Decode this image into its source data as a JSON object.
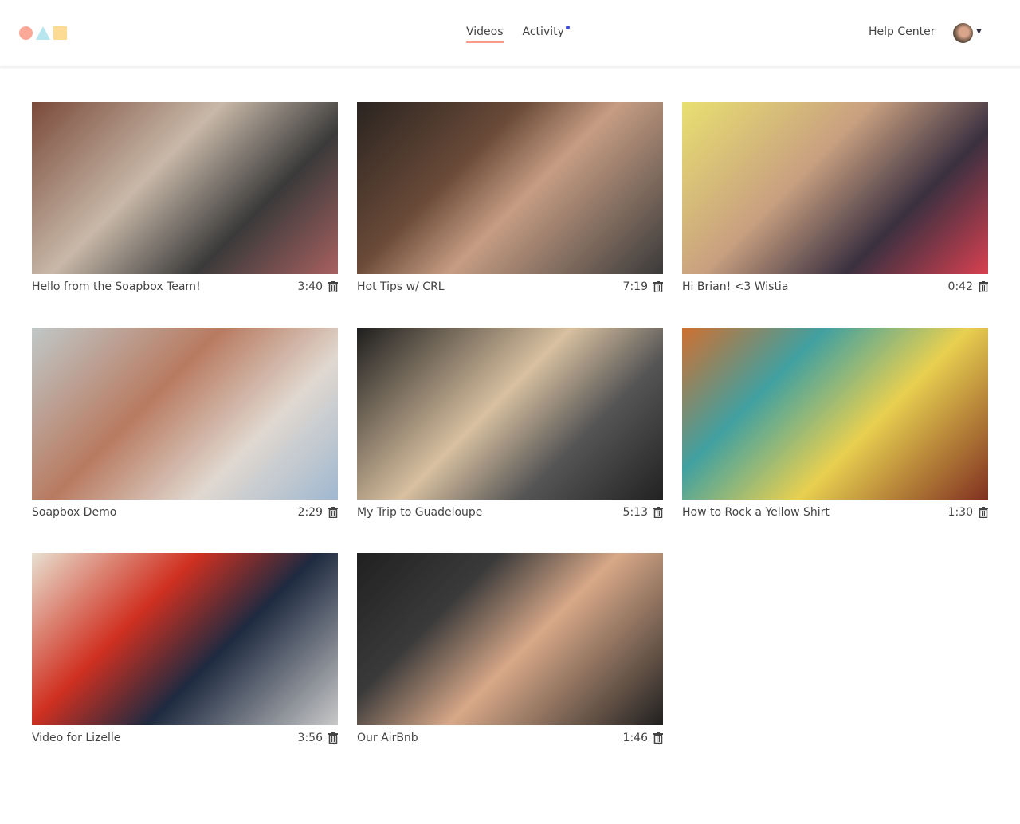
{
  "nav": {
    "videos": "Videos",
    "activity": "Activity",
    "help": "Help Center"
  },
  "colors": {
    "accent": "#fc9a88",
    "notification": "#3b4bd8"
  },
  "videos": [
    {
      "title": "Hello from the Soapbox Team!",
      "duration": "3:40",
      "bg": "linear-gradient(135deg,#7a4a3a 0%,#c8b8a8 40%,#3a3a3a 70%,#a86060 100%)"
    },
    {
      "title": "Hot Tips w/ CRL",
      "duration": "7:19",
      "bg": "linear-gradient(135deg,#2a2420 0%,#6a4a38 35%,#c79d83 55%,#3a3a3a 100%)"
    },
    {
      "title": "Hi Brian! <3 Wistia",
      "duration": "0:42",
      "bg": "linear-gradient(135deg,#e8e070 0%,#c9a080 40%,#3a3040 70%,#d84050 100%)"
    },
    {
      "title": "Soapbox Demo",
      "duration": "2:29",
      "bg": "linear-gradient(135deg,#c0c8c8 0%,#b87a60 40%,#e0d8d0 70%,#a0b8d0 100%)"
    },
    {
      "title": "My Trip to Guadeloupe",
      "duration": "5:13",
      "bg": "linear-gradient(135deg,#1e1e1e 0%,#d8c0a0 45%,#555 70%,#222 100%)"
    },
    {
      "title": "How to Rock a Yellow Shirt",
      "duration": "1:30",
      "bg": "linear-gradient(135deg,#d07030 0%,#40a0a0 30%,#e8d050 60%,#803020 100%)"
    },
    {
      "title": "Video for Lizelle",
      "duration": "3:56",
      "bg": "linear-gradient(135deg,#e8e0d0 0%,#d03020 35%,#1e2a40 60%,#c8c8c8 100%)"
    },
    {
      "title": "Our AirBnb",
      "duration": "1:46",
      "bg": "linear-gradient(135deg,#202020 0%,#3a3a3a 30%,#d8a888 55%,#202020 100%)"
    }
  ]
}
